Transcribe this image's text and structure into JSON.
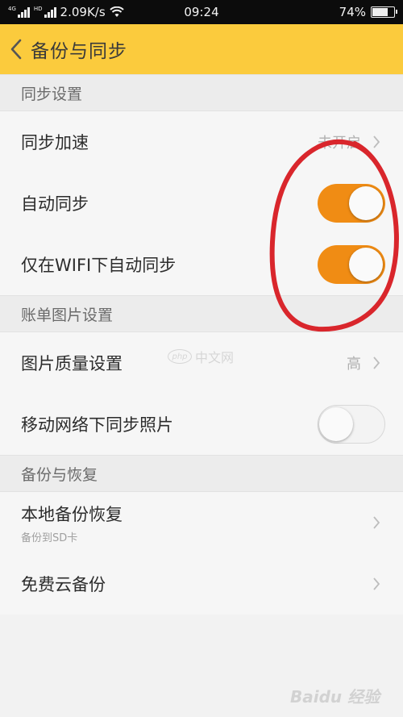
{
  "status_bar": {
    "network_speed": "2.09K/s",
    "time": "09:24",
    "battery": "74%",
    "battery_level": 0.74,
    "sim_tags": [
      "4G",
      "HD"
    ]
  },
  "header": {
    "title": "备份与同步",
    "back_icon": "chevron-left-icon"
  },
  "sections": [
    {
      "title": "同步设置",
      "rows": [
        {
          "label": "同步加速",
          "value": "未开启",
          "type": "nav"
        },
        {
          "label": "自动同步",
          "type": "toggle",
          "on": true
        },
        {
          "label": "仅在WIFI下自动同步",
          "type": "toggle",
          "on": true
        }
      ]
    },
    {
      "title": "账单图片设置",
      "rows": [
        {
          "label": "图片质量设置",
          "value": "高",
          "type": "nav"
        },
        {
          "label": "移动网络下同步照片",
          "type": "toggle",
          "on": false
        }
      ]
    },
    {
      "title": "备份与恢复",
      "rows": [
        {
          "label": "本地备份恢复",
          "sublabel": "备份到SD卡",
          "type": "nav"
        },
        {
          "label": "免费云备份",
          "type": "nav"
        }
      ]
    }
  ],
  "watermarks": {
    "php": "php",
    "php_cn": "中文网",
    "baidu": "Baidu 经验"
  },
  "colors": {
    "accent": "#fbcb3d",
    "toggle_on": "#f08c14",
    "annotation": "#d9262c"
  }
}
